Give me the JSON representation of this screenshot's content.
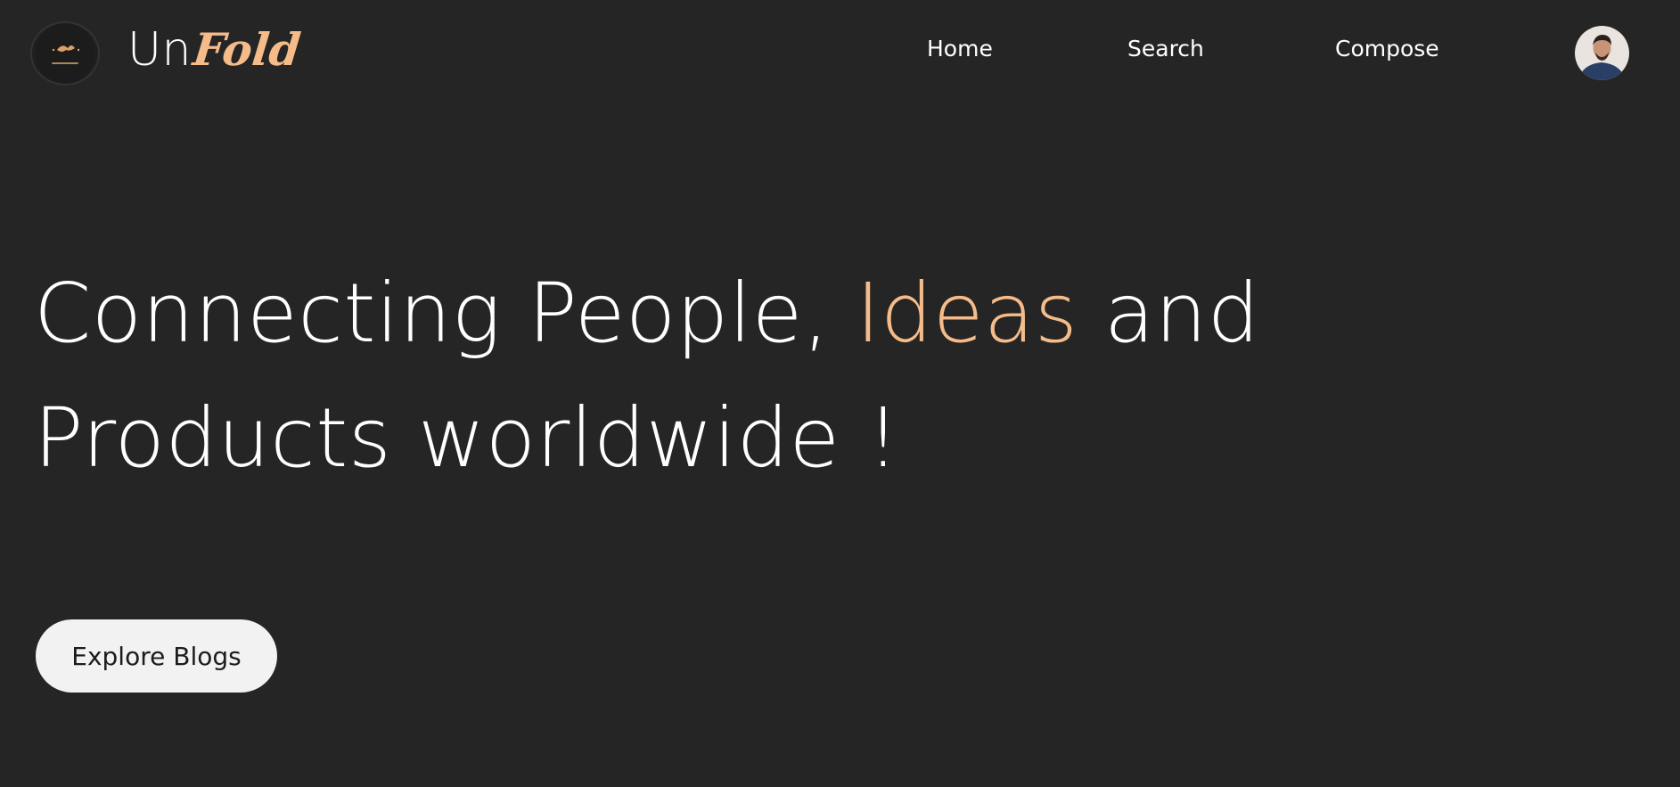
{
  "colors": {
    "background": "#252525",
    "text": "#ffffff",
    "accent": "#f5bc8a",
    "button_bg": "#f2f2f2",
    "button_text": "#1c1c1c"
  },
  "brand": {
    "logo_icon": "brand-badge-icon",
    "name_part1": "Un",
    "name_part2": "Fold"
  },
  "nav": {
    "items": [
      {
        "label": "Home"
      },
      {
        "label": "Search"
      },
      {
        "label": "Compose"
      }
    ],
    "avatar_icon": "user-avatar-icon"
  },
  "hero": {
    "title_part1": "Connecting People, ",
    "title_accent": "Ideas",
    "title_part2": " and Products worldwide !",
    "cta_label": "Explore Blogs"
  }
}
